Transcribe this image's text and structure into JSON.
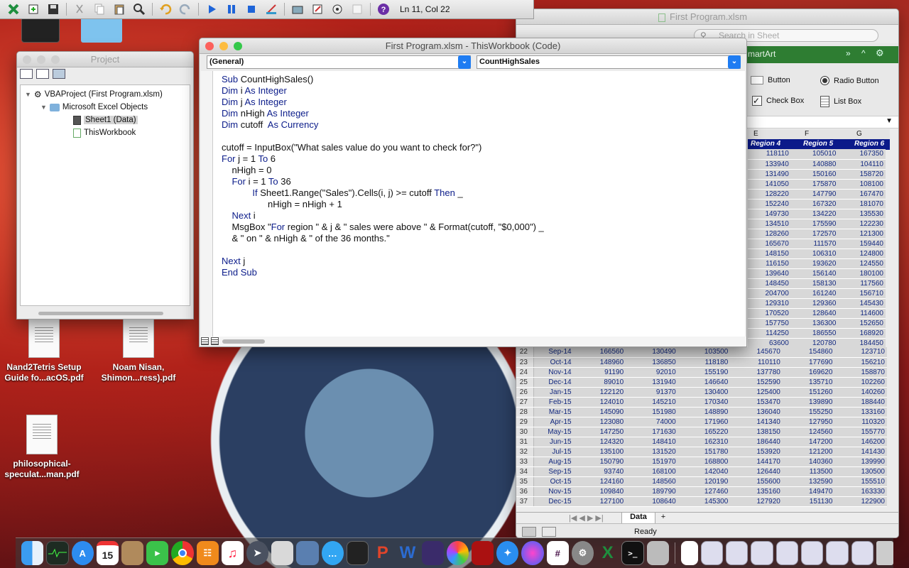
{
  "vbe_toolbar": {
    "cursor_position": "Ln 11, Col 22"
  },
  "desktop": {
    "icons": [
      {
        "label": "Nand2Tetris Setup Guide fo...acOS.pdf"
      },
      {
        "label": "Noam Nisan, Shimon...ress).pdf"
      },
      {
        "label": "philosophical-speculat...man.pdf"
      }
    ]
  },
  "project": {
    "title": "Project",
    "tree": [
      {
        "label": "VBAProject (First Program.xlsm)"
      },
      {
        "label": "Microsoft Excel Objects"
      },
      {
        "label": "Sheet1 (Data)"
      },
      {
        "label": "ThisWorkbook"
      }
    ]
  },
  "code_window": {
    "title": "First Program.xlsm - ThisWorkbook (Code)",
    "object_combo": "(General)",
    "procedure_combo": "CountHighSales",
    "lines": [
      "Sub CountHighSales()",
      "Dim i As Integer",
      "Dim j As Integer",
      "Dim nHigh As Integer",
      "Dim cutoff  As Currency",
      "",
      "cutoff = InputBox(\"What sales value do you want to check for?\")",
      "For j = 1 To 6",
      "    nHigh = 0",
      "    For i = 1 To 36",
      "            If Sheet1.Range(\"Sales\").Cells(i, j) >= cutoff Then _",
      "                  nHigh = nHigh + 1",
      "    Next i",
      "    MsgBox \"For region \" & j & \" sales were above \" & Format(cutoff, \"$0,000\") _",
      "    & \" on \" & nHigh & \" of the 36 months.\"",
      "",
      "Next j",
      "End Sub"
    ]
  },
  "excel": {
    "title": "First Program.xlsm",
    "search_placeholder": "Search in Sheet",
    "smartart_tab": "martArt",
    "controls": {
      "button": "Button",
      "radio": "Radio Button",
      "checkbox": "Check Box",
      "listbox": "List Box"
    },
    "col_letters": [
      "E",
      "F",
      "G"
    ],
    "headers": [
      "Region 4",
      "Region 5",
      "Region 6"
    ],
    "upper_rows": [
      [
        "118110",
        "105010",
        "167350"
      ],
      [
        "133940",
        "140880",
        "104110"
      ],
      [
        "131490",
        "150160",
        "158720"
      ],
      [
        "141050",
        "175870",
        "108100"
      ],
      [
        "128220",
        "147790",
        "167470"
      ],
      [
        "152240",
        "167320",
        "181070"
      ],
      [
        "149730",
        "134220",
        "135530"
      ],
      [
        "134510",
        "175590",
        "122230"
      ],
      [
        "128260",
        "172570",
        "121300"
      ],
      [
        "165670",
        "111570",
        "159440"
      ],
      [
        "148150",
        "106310",
        "124800"
      ],
      [
        "116150",
        "193620",
        "124550"
      ],
      [
        "139640",
        "156140",
        "180100"
      ],
      [
        "148450",
        "158130",
        "117560"
      ],
      [
        "204700",
        "161240",
        "156710"
      ],
      [
        "129310",
        "129360",
        "145430"
      ],
      [
        "170520",
        "128640",
        "114600"
      ],
      [
        "157750",
        "136300",
        "152650"
      ],
      [
        "114250",
        "186550",
        "168920"
      ],
      [
        "63600",
        "120780",
        "184450"
      ]
    ],
    "lower_rows": [
      {
        "row": "22",
        "month": "Sep-14",
        "v": [
          "166560",
          "130490",
          "103500",
          "145670",
          "154860",
          "123710"
        ]
      },
      {
        "row": "23",
        "month": "Oct-14",
        "v": [
          "148960",
          "136850",
          "118180",
          "110110",
          "177690",
          "156210"
        ]
      },
      {
        "row": "24",
        "month": "Nov-14",
        "v": [
          "91190",
          "92010",
          "155190",
          "137780",
          "169620",
          "158870"
        ]
      },
      {
        "row": "25",
        "month": "Dec-14",
        "v": [
          "89010",
          "131940",
          "146640",
          "152590",
          "135710",
          "102260"
        ]
      },
      {
        "row": "26",
        "month": "Jan-15",
        "v": [
          "122120",
          "91370",
          "130400",
          "125400",
          "151260",
          "140260"
        ]
      },
      {
        "row": "27",
        "month": "Feb-15",
        "v": [
          "124010",
          "145210",
          "170340",
          "153470",
          "139890",
          "188440"
        ]
      },
      {
        "row": "28",
        "month": "Mar-15",
        "v": [
          "145090",
          "151980",
          "148890",
          "136040",
          "155250",
          "133160"
        ]
      },
      {
        "row": "29",
        "month": "Apr-15",
        "v": [
          "123080",
          "74000",
          "171960",
          "141340",
          "127950",
          "110320"
        ]
      },
      {
        "row": "30",
        "month": "May-15",
        "v": [
          "147250",
          "171630",
          "165220",
          "138150",
          "124560",
          "155770"
        ]
      },
      {
        "row": "31",
        "month": "Jun-15",
        "v": [
          "124320",
          "148410",
          "162310",
          "186440",
          "147200",
          "146200"
        ]
      },
      {
        "row": "32",
        "month": "Jul-15",
        "v": [
          "135100",
          "131520",
          "151780",
          "153920",
          "121200",
          "141430"
        ]
      },
      {
        "row": "33",
        "month": "Aug-15",
        "v": [
          "150790",
          "151970",
          "168800",
          "144170",
          "140360",
          "139990"
        ]
      },
      {
        "row": "34",
        "month": "Sep-15",
        "v": [
          "93740",
          "168100",
          "142040",
          "126440",
          "113500",
          "130500"
        ]
      },
      {
        "row": "35",
        "month": "Oct-15",
        "v": [
          "124160",
          "148560",
          "120190",
          "155600",
          "132590",
          "155510"
        ]
      },
      {
        "row": "36",
        "month": "Nov-15",
        "v": [
          "109840",
          "189790",
          "127460",
          "135160",
          "149470",
          "163330"
        ]
      },
      {
        "row": "37",
        "month": "Dec-15",
        "v": [
          "127100",
          "108640",
          "145300",
          "127920",
          "151130",
          "122900"
        ]
      }
    ],
    "sheet_tab": "Data",
    "status": "Ready"
  },
  "dock": {
    "calendar_day": "15"
  }
}
